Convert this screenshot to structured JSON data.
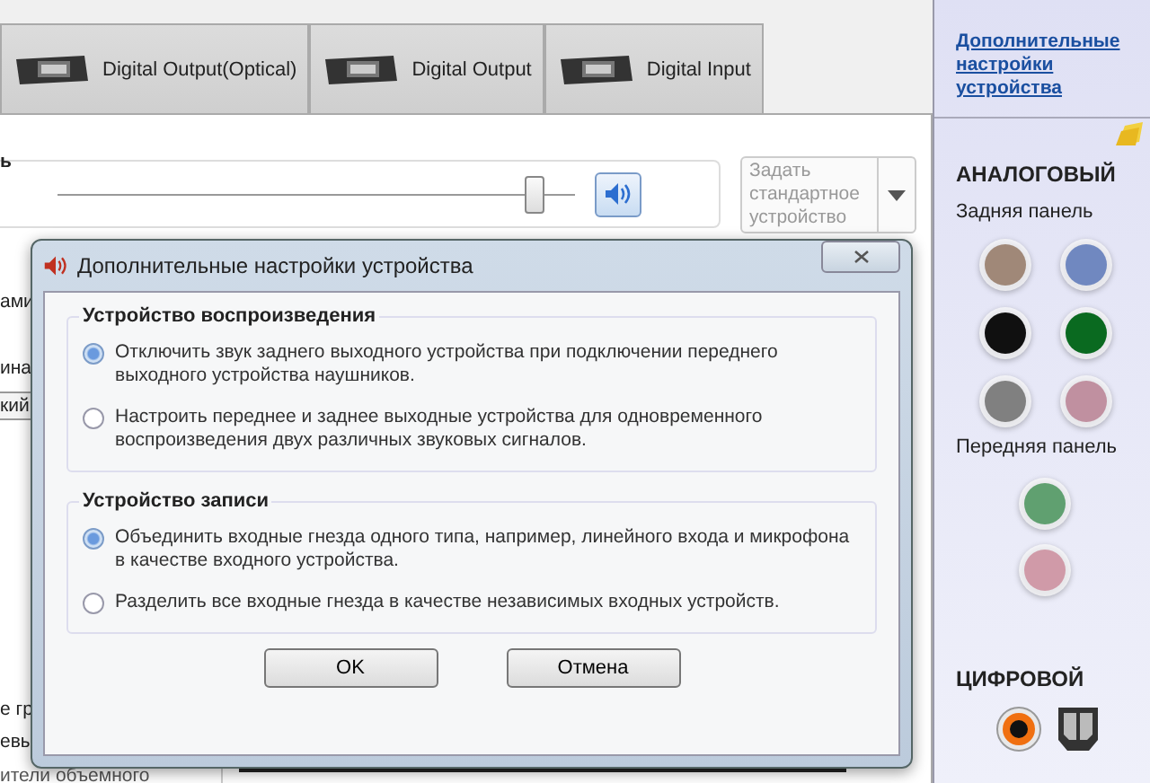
{
  "tabs": [
    {
      "label": "Digital Output(Optical)",
      "selected": false
    },
    {
      "label": "Digital Output",
      "selected": false
    },
    {
      "label": "Digital Input",
      "selected": false
    }
  ],
  "main": {
    "label_fragment": "ь",
    "volume": {
      "level": 0.92
    },
    "mute_button": {
      "muted": false
    },
    "default_dropdown": {
      "label": "Задать стандартное устройство"
    },
    "left_fragments": [
      "ами",
      "ина",
      "кий",
      "е гр",
      "евы",
      "ители объемного"
    ]
  },
  "dialog": {
    "title": "Дополнительные настройки устройства",
    "groups": [
      {
        "title": "Устройство воспроизведения",
        "options": [
          {
            "label": "Отключить звук заднего выходного устройства при подключении переднего выходного устройства наушников.",
            "selected": true
          },
          {
            "label": "Настроить переднее и заднее выходные устройства для одновременного воспроизведения двух различных звуковых сигналов.",
            "selected": false
          }
        ]
      },
      {
        "title": "Устройство записи",
        "options": [
          {
            "label": "Объединить входные гнезда одного типа, например, линейного входа и микрофона в качестве входного устройства.",
            "selected": true
          },
          {
            "label": "Разделить все входные гнезда в качестве независимых входных устройств.",
            "selected": false
          }
        ]
      }
    ],
    "buttons": [
      "OK",
      "Отмена"
    ]
  },
  "sidebar": {
    "link": "Дополнительные настройки устройства",
    "analog_title": "АНАЛОГОВЫЙ",
    "rear_label": "Задняя панель",
    "rear_jacks": [
      {
        "color": "#a08878"
      },
      {
        "color": "#7088c0"
      },
      {
        "color": "#101010"
      },
      {
        "color": "#0a6a20"
      },
      {
        "color": "#808080"
      },
      {
        "color": "#c090a0"
      }
    ],
    "front_label": "Передняя панель",
    "front_jacks": [
      {
        "color": "#60a070"
      },
      {
        "color": "#d09aa8"
      }
    ],
    "digital_title": "ЦИФРОВОЙ"
  }
}
